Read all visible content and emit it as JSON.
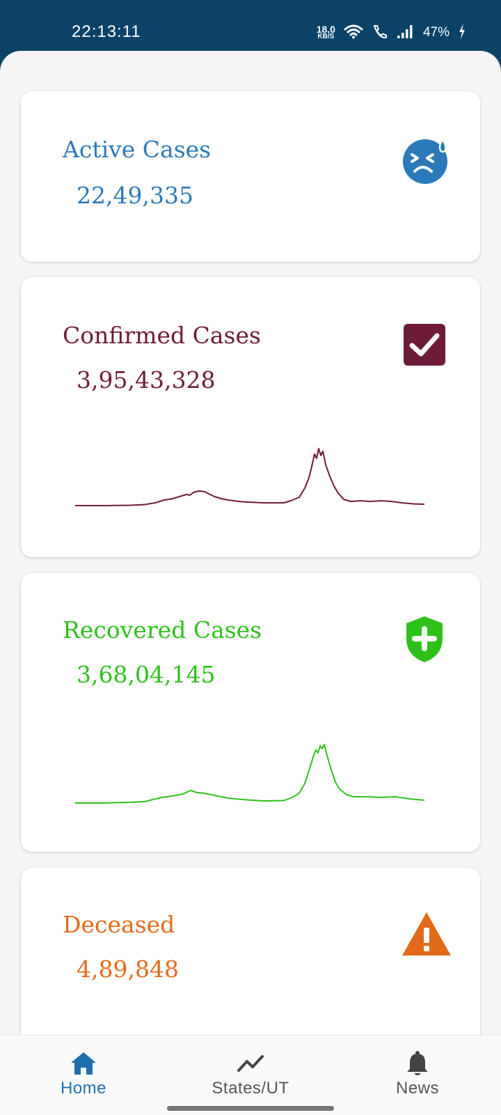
{
  "status_bar": {
    "time": "22:13:11",
    "net_speed_value": "18.0",
    "net_speed_unit": "KB/S",
    "battery": "47%"
  },
  "cards": {
    "active": {
      "title": "Active Cases",
      "value": "22,49,335",
      "color": "#2a7ab9",
      "icon": "sad-face-icon"
    },
    "confirmed": {
      "title": "Confirmed Cases",
      "value": "3,95,43,328",
      "color": "#6e1b3a",
      "icon": "checkbox-check-icon"
    },
    "recovered": {
      "title": "Recovered Cases",
      "value": "3,68,04,145",
      "color": "#2ec11a",
      "icon": "shield-plus-icon"
    },
    "deceased": {
      "title": "Deceased",
      "value": "4,89,848",
      "color": "#e36a1a",
      "icon": "warning-triangle-icon"
    }
  },
  "bottom_nav": {
    "items": [
      {
        "label": "Home",
        "icon": "home-icon",
        "active": true
      },
      {
        "label": "States/UT",
        "icon": "trend-line-icon",
        "active": false
      },
      {
        "label": "News",
        "icon": "bell-icon",
        "active": false
      }
    ]
  }
}
